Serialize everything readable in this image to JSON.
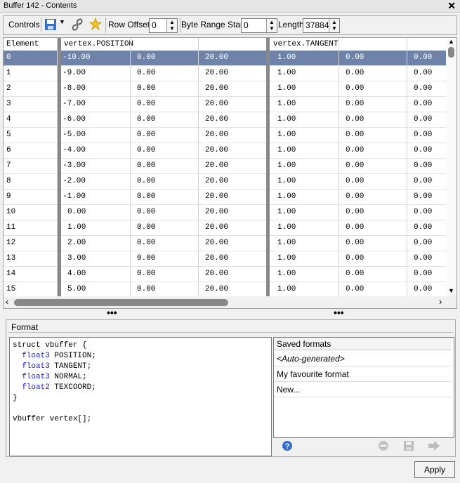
{
  "window": {
    "title": "Buffer 142 - Contents"
  },
  "toolbar": {
    "controls_label": "Controls",
    "row_offset_label": "Row Offset",
    "row_offset_value": "0",
    "byte_range_label": "Byte Range Start",
    "byte_range_value": "0",
    "length_label": "Length",
    "length_value": "37884"
  },
  "grid": {
    "headers": {
      "element": "Element",
      "position": "vertex.POSITION",
      "tangent": "vertex.TANGENT"
    },
    "rows": [
      [
        "0",
        "-10.00",
        "0.00",
        "20.00",
        "1.00",
        "0.00",
        "0.00"
      ],
      [
        "1",
        "-9.00",
        "0.00",
        "20.00",
        "1.00",
        "0.00",
        "0.00"
      ],
      [
        "2",
        "-8.00",
        "0.00",
        "20.00",
        "1.00",
        "0.00",
        "0.00"
      ],
      [
        "3",
        "-7.00",
        "0.00",
        "20.00",
        "1.00",
        "0.00",
        "0.00"
      ],
      [
        "4",
        "-6.00",
        "0.00",
        "20.00",
        "1.00",
        "0.00",
        "0.00"
      ],
      [
        "5",
        "-5.00",
        "0.00",
        "20.00",
        "1.00",
        "0.00",
        "0.00"
      ],
      [
        "6",
        "-4.00",
        "0.00",
        "20.00",
        "1.00",
        "0.00",
        "0.00"
      ],
      [
        "7",
        "-3.00",
        "0.00",
        "20.00",
        "1.00",
        "0.00",
        "0.00"
      ],
      [
        "8",
        "-2.00",
        "0.00",
        "20.00",
        "1.00",
        "0.00",
        "0.00"
      ],
      [
        "9",
        "-1.00",
        "0.00",
        "20.00",
        "1.00",
        "0.00",
        "0.00"
      ],
      [
        "10",
        "0.00",
        "0.00",
        "20.00",
        "1.00",
        "0.00",
        "0.00"
      ],
      [
        "11",
        "1.00",
        "0.00",
        "20.00",
        "1.00",
        "0.00",
        "0.00"
      ],
      [
        "12",
        "2.00",
        "0.00",
        "20.00",
        "1.00",
        "0.00",
        "0.00"
      ],
      [
        "13",
        "3.00",
        "0.00",
        "20.00",
        "1.00",
        "0.00",
        "0.00"
      ],
      [
        "14",
        "4.00",
        "0.00",
        "20.00",
        "1.00",
        "0.00",
        "0.00"
      ],
      [
        "15",
        "5.00",
        "0.00",
        "20.00",
        "1.00",
        "0.00",
        "0.00"
      ]
    ],
    "selected_row": 0,
    "selection_color": "#6f82a7"
  },
  "splitter": {
    "grip": "•••"
  },
  "format": {
    "title": "Format",
    "code": {
      "struct_line": "struct vbuffer {",
      "fields": [
        {
          "type": "float3",
          "name": "POSITION;"
        },
        {
          "type": "float3",
          "name": "TANGENT;"
        },
        {
          "type": "float3",
          "name": "NORMAL;"
        },
        {
          "type": "float2",
          "name": "TEXCOORD;"
        }
      ],
      "close_brace": "}",
      "decl_line": "vbuffer vertex[];"
    },
    "saved": {
      "header": "Saved formats",
      "items": [
        "<Auto-generated>",
        "My favourite format",
        "New..."
      ]
    }
  },
  "apply_label": "Apply",
  "icons": [
    "save-icon",
    "dropdown-arrow-icon",
    "link-icon",
    "star-icon",
    "close-icon",
    "help-icon",
    "remove-icon",
    "save-format-icon",
    "forward-icon"
  ]
}
